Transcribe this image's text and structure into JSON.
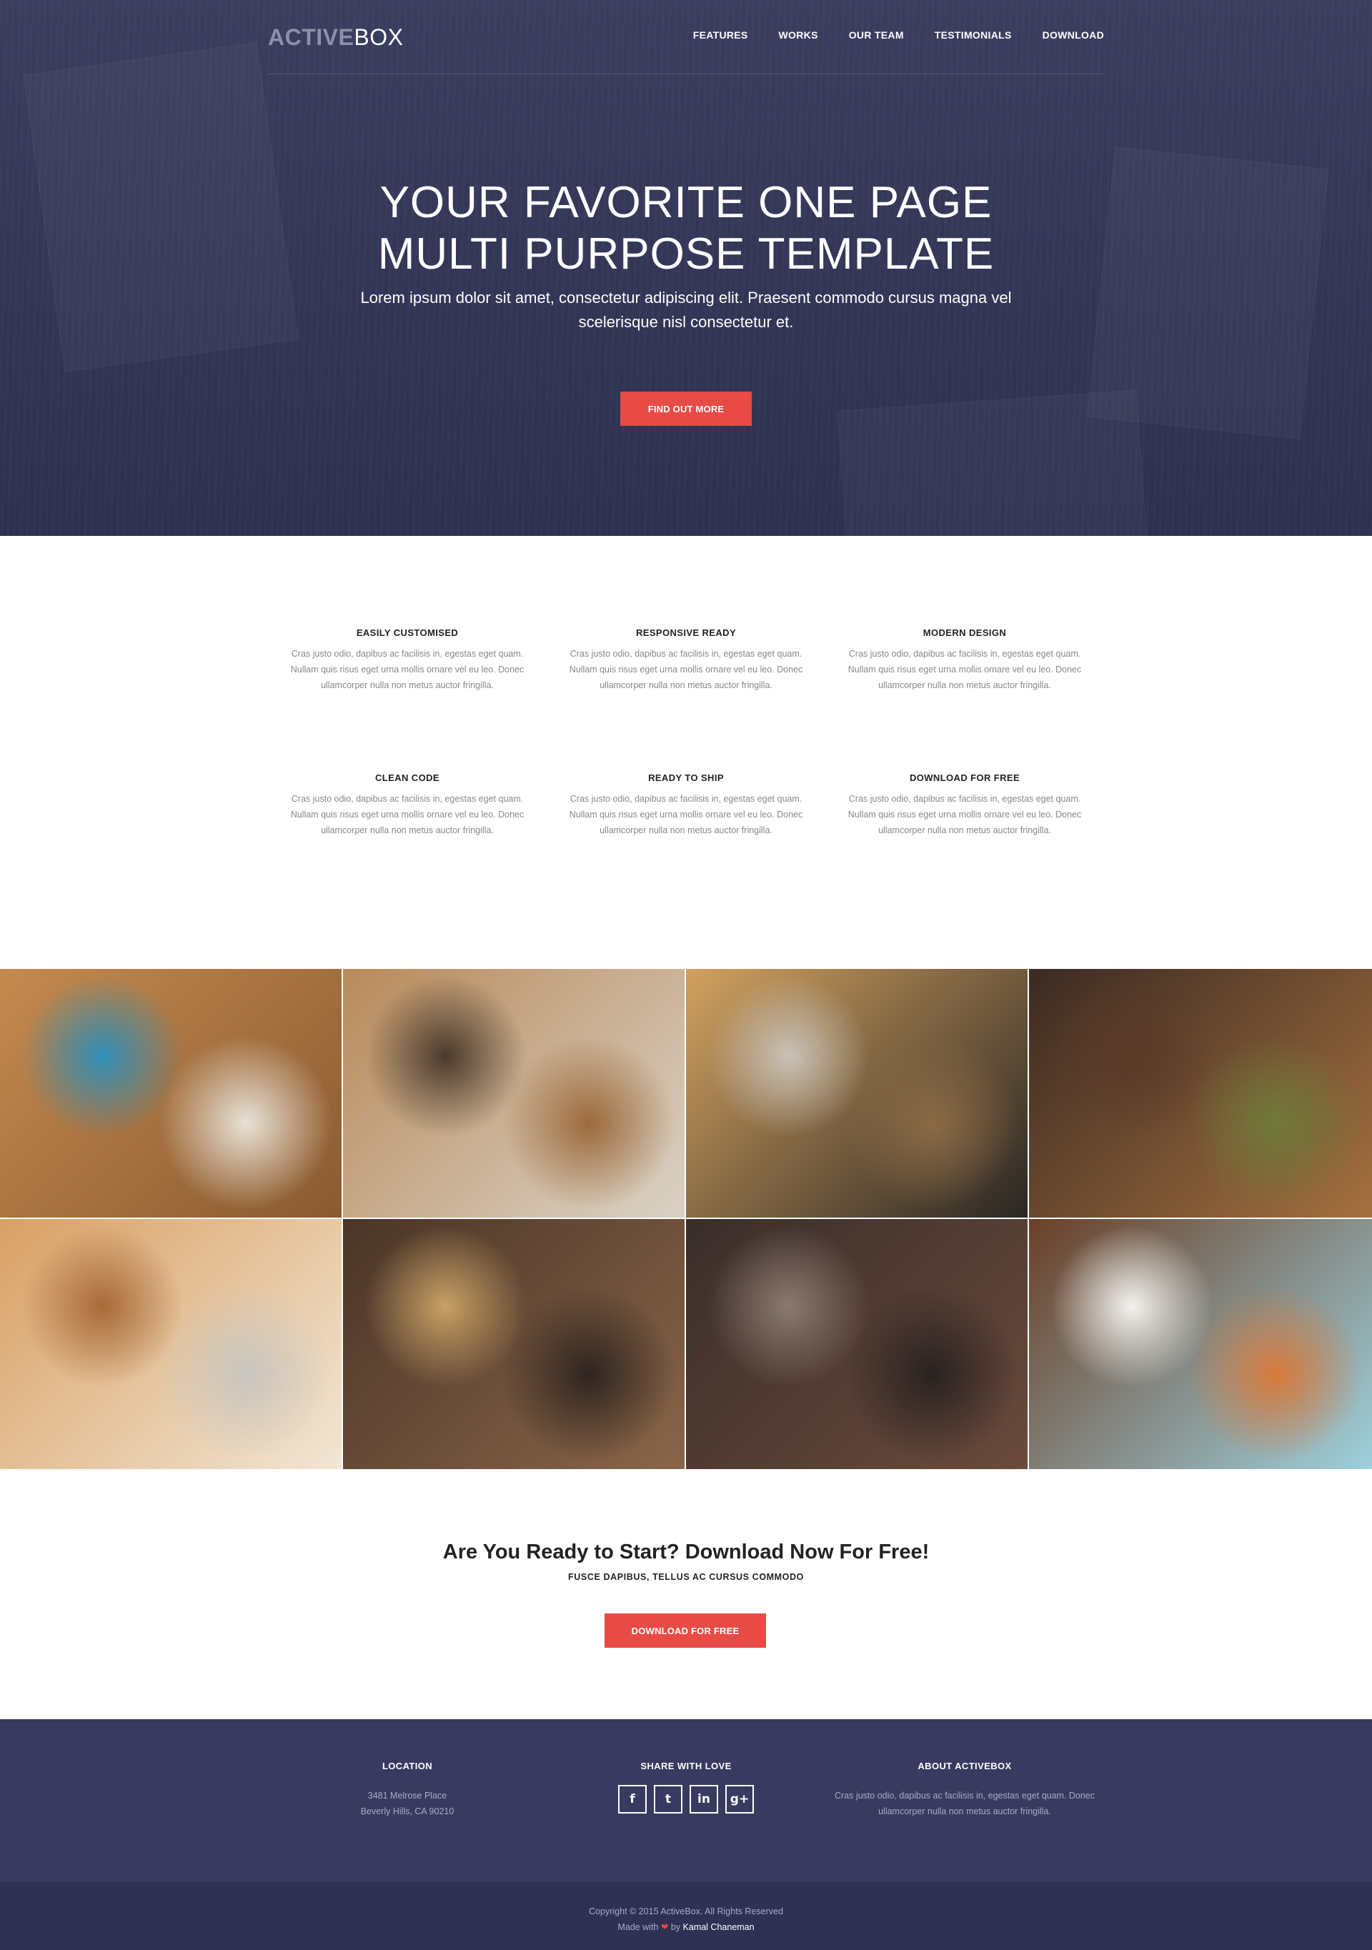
{
  "brand": {
    "logo_part1": "ACTIVE",
    "logo_part2": "BOX"
  },
  "nav": {
    "items": [
      {
        "label": "FEATURES"
      },
      {
        "label": "WORKS"
      },
      {
        "label": "OUR TEAM"
      },
      {
        "label": "TESTIMONIALS"
      },
      {
        "label": "DOWNLOAD"
      }
    ]
  },
  "hero": {
    "title_line1": "YOUR FAVORITE ONE PAGE",
    "title_line2": "MULTI PURPOSE TEMPLATE",
    "text": "Lorem ipsum dolor sit amet, consectetur adipiscing elit. Praesent commodo cursus magna vel scelerisque nisl consectetur et.",
    "button_label": "FIND OUT MORE"
  },
  "features": [
    {
      "title": "EASILY CUSTOMISED",
      "text": "Cras justo odio, dapibus ac facilisis in, egestas eget quam. Nullam quis risus eget urna mollis ornare vel eu leo. Donec ullamcorper nulla non metus auctor fringilla."
    },
    {
      "title": "RESPONSIVE READY",
      "text": "Cras justo odio, dapibus ac facilisis in, egestas eget quam. Nullam quis risus eget urna mollis ornare vel eu leo. Donec ullamcorper nulla non metus auctor fringilla."
    },
    {
      "title": "MODERN DESIGN",
      "text": "Cras justo odio, dapibus ac facilisis in, egestas eget quam. Nullam quis risus eget urna mollis ornare vel eu leo. Donec ullamcorper nulla non metus auctor fringilla."
    },
    {
      "title": "CLEAN CODE",
      "text": "Cras justo odio, dapibus ac facilisis in, egestas eget quam. Nullam quis risus eget urna mollis ornare vel eu leo. Donec ullamcorper nulla non metus auctor fringilla."
    },
    {
      "title": "READY TO SHIP",
      "text": "Cras justo odio, dapibus ac facilisis in, egestas eget quam. Nullam quis risus eget urna mollis ornare vel eu leo. Donec ullamcorper nulla non metus auctor fringilla."
    },
    {
      "title": "DOWNLOAD FOR FREE",
      "text": "Cras justo odio, dapibus ac facilisis in, egestas eget quam. Nullam quis risus eget urna mollis ornare vel eu leo. Donec ullamcorper nulla non metus auctor fringilla."
    }
  ],
  "gallery": {
    "tiles": [
      {
        "subject": "stationery-flatlay-photo",
        "colors": [
          "#c48a4f",
          "#8a5a30",
          "#2f8fb6",
          "#e8e2d8"
        ]
      },
      {
        "subject": "notebook-dont-just-stand-there-photo",
        "colors": [
          "#b98a5a",
          "#d9d2c6",
          "#4a3a2c",
          "#9c6a3c"
        ]
      },
      {
        "subject": "vintage-cameras-photo",
        "colors": [
          "#d2a15f",
          "#2a2623",
          "#c9c2b8",
          "#8b6a45"
        ]
      },
      {
        "subject": "cutting-board-kitchen-photo",
        "colors": [
          "#3b2a22",
          "#a5703f",
          "#5b3a28",
          "#6f7a3a"
        ]
      },
      {
        "subject": "pencils-on-wood-photo",
        "colors": [
          "#d9a064",
          "#f2e6d4",
          "#a86a38",
          "#c9c6c0"
        ]
      },
      {
        "subject": "vintage-tools-photo",
        "colors": [
          "#4a3528",
          "#8a6548",
          "#c8a064",
          "#2f2520"
        ]
      },
      {
        "subject": "letterpress-type-photo",
        "colors": [
          "#3a2e2a",
          "#6a4a3c",
          "#8a7a70",
          "#2a2220"
        ]
      },
      {
        "subject": "food-on-plank-photo",
        "colors": [
          "#6a4028",
          "#9ed0dc",
          "#f5f2ee",
          "#d87a3a"
        ]
      }
    ]
  },
  "cta": {
    "title": "Are You Ready to Start? Download Now For Free!",
    "subtitle": "FUSCE DAPIBUS, TELLUS AC CURSUS COMMODO",
    "button_label": "DOWNLOAD FOR FREE"
  },
  "footer": {
    "location": {
      "title": "LOCATION",
      "line1": "3481 Melrose Place",
      "line2": "Beverly Hills, CA 90210"
    },
    "share": {
      "title": "SHARE WITH LOVE",
      "icons": [
        {
          "name": "facebook-icon",
          "glyph": "f"
        },
        {
          "name": "twitter-icon",
          "glyph": "t"
        },
        {
          "name": "linkedin-icon",
          "glyph": "in"
        },
        {
          "name": "google-plus-icon",
          "glyph": "g+"
        }
      ]
    },
    "about": {
      "title": "ABOUT ACTIVEBOX",
      "text": "Cras justo odio, dapibus ac facilisis in, egestas eget quam. Donec ullamcorper nulla non metus auctor fringilla."
    }
  },
  "bottom": {
    "copyright": "Copyright © 2015 ActiveBox. All Rights Reserved",
    "made_with": "Made with",
    "by": "by",
    "author": "Kamal Chaneman"
  },
  "colors": {
    "hero_bg": "#333656",
    "accent": "#e84b46",
    "footer_bg": "#383a60",
    "bottom_bg": "#2e3054"
  }
}
